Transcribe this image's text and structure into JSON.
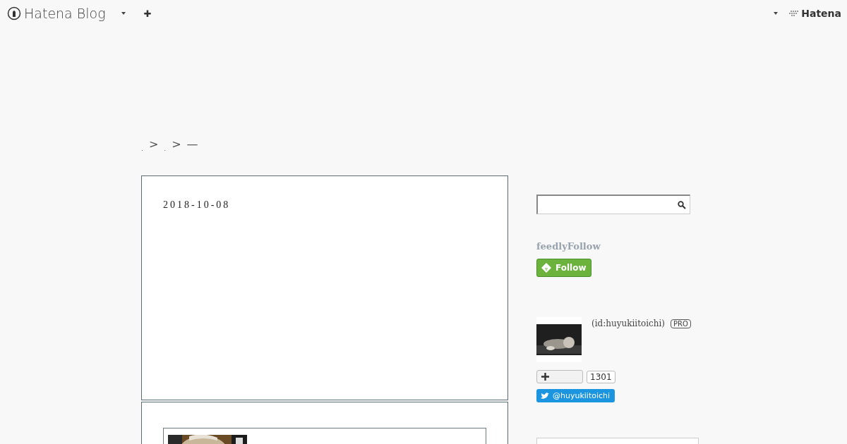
{
  "header": {
    "logo": "Hatena Blog",
    "add_symbol": "✚",
    "brand": "Hatena"
  },
  "breadcrumb": [
    {
      "text": "."
    },
    {
      "text": "."
    },
    {
      "text": "—"
    }
  ],
  "breadcrumb_separator": ">",
  "article": {
    "date": "2018-10-08"
  },
  "sidebar": {
    "feedly": {
      "title": "feedlyFollow",
      "button": "Follow"
    },
    "profile": {
      "id": "(id:huyukiitoichi)",
      "badge": "PRO"
    },
    "subscribe": {
      "count": "1301"
    },
    "twitter": {
      "handle": "@huyukiitoichi"
    }
  }
}
